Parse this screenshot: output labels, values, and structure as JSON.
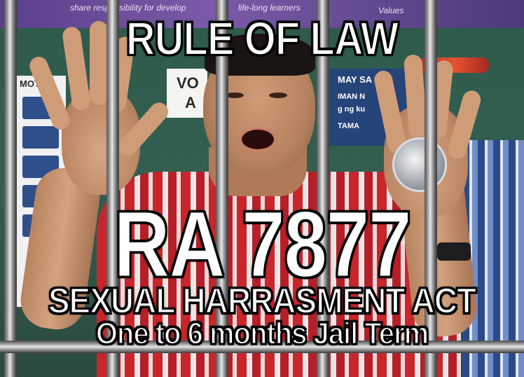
{
  "meme": {
    "headline": "RULE OF LAW",
    "law_number": "RA 7877",
    "law_name": "SEXUAL HARRASMENT ACT",
    "penalty": "One to 6 months Jail Term"
  },
  "background": {
    "banner_left": "share responsibility for develop",
    "banner_mid": "life-long learners",
    "banner_right": "Values",
    "sign_vote": "VO",
    "sign_vote_line2": "A",
    "poster_left": "MOTO",
    "sign_right_1": "MAY SA",
    "sign_right_2": "IMAN N",
    "sign_right_3": "g ng ku",
    "sign_right_4": "TAMA"
  },
  "colors": {
    "caption_fill": "#ffffff",
    "caption_outline": "#000000",
    "shirt_red": "#c8262b",
    "wall_green": "#2e5a4b",
    "bar_steel": "#b0b0b0"
  }
}
